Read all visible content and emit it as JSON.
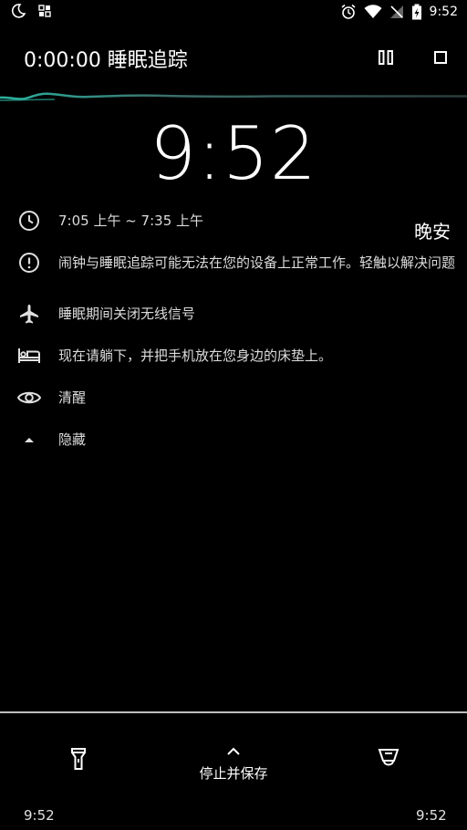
{
  "status_bar": {
    "time": "9:52",
    "icons": [
      "moon-icon",
      "grid-app-icon",
      "alarm-icon",
      "wifi-icon",
      "no-signal-icon",
      "battery-charging-icon"
    ]
  },
  "app_bar": {
    "title": "0:00:00 睡眠追踪",
    "actions": [
      "pause-icon",
      "stop-icon"
    ]
  },
  "clock": {
    "time": "9:52"
  },
  "info": {
    "alarm_range": "7:05 上午 ~ 7:35 上午",
    "goodnight": "晚安",
    "warning": "闹钟与睡眠追踪可能无法在您的设备上正常工作。轻触以解决问题",
    "airplane": "睡眠期间关闭无线信号",
    "bed": "现在请躺下，并把手机放在您身边的床垫上。",
    "awake": "清醒",
    "hide": "隐藏"
  },
  "bottom": {
    "stop_save": "停止并保存",
    "left_time": "9:52",
    "right_time": "9:52"
  },
  "colors": {
    "background": "#000000",
    "wave_accent": "#2bb3a0"
  }
}
